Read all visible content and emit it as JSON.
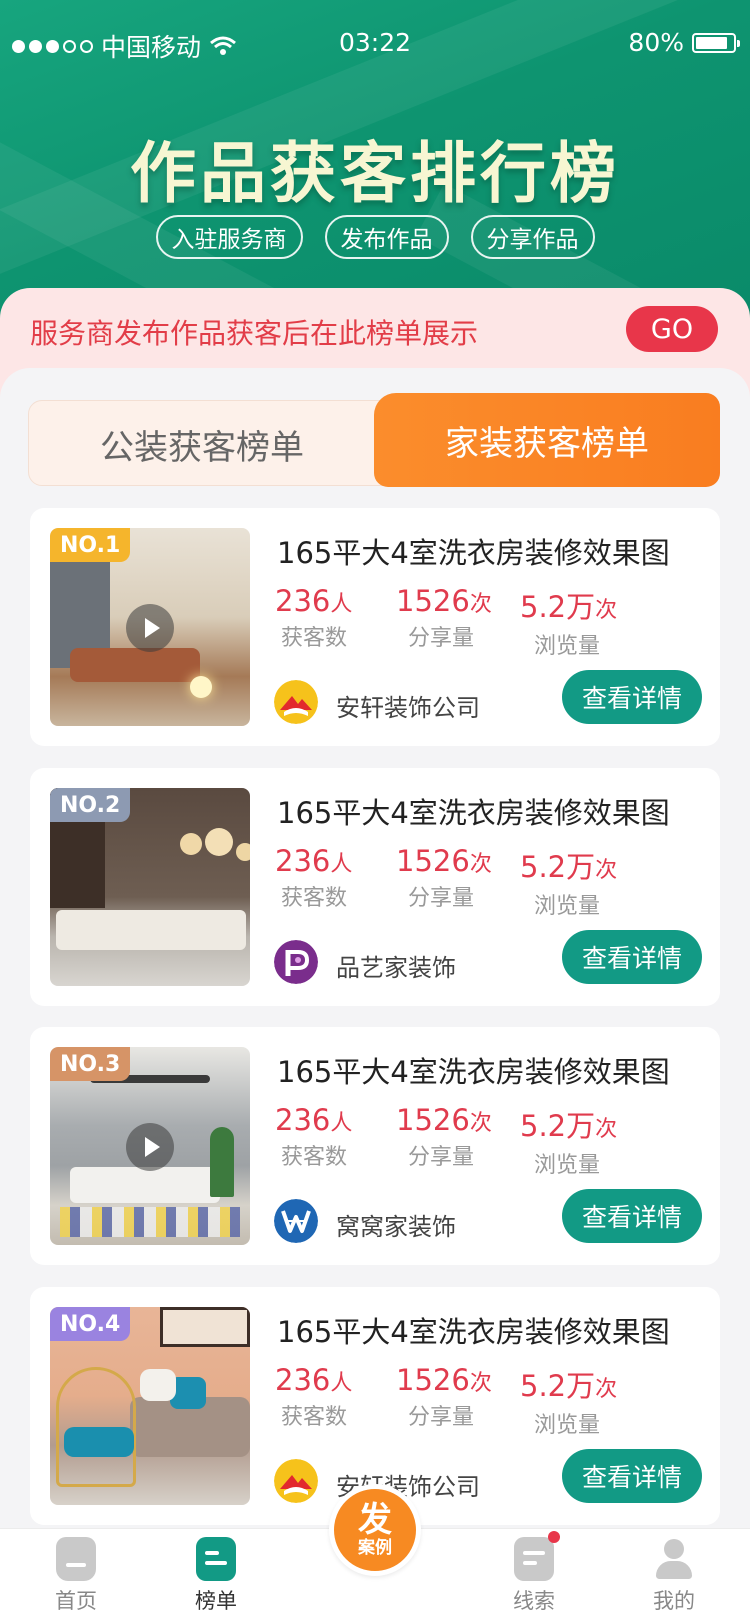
{
  "status_bar": {
    "carrier": "中国移动",
    "time": "03:22",
    "battery": "80%"
  },
  "hero": {
    "title": "作品获客排行榜",
    "buttons": [
      "入驻服务商",
      "发布作品",
      "分享作品"
    ]
  },
  "notice": {
    "text": "服务商发布作品获客后在此榜单展示",
    "go_label": "GO"
  },
  "tabs": [
    {
      "label": "公装获客榜单",
      "active": false
    },
    {
      "label": "家装获客榜单",
      "active": true
    }
  ],
  "cards": [
    {
      "rank": "NO.1",
      "rank_color": "#f5b52c",
      "title": "165平大4室洗衣房装修效果图",
      "customers": "236",
      "customers_unit": "人",
      "customers_label": "获客数",
      "shares": "1526",
      "shares_unit": "次",
      "shares_label": "分享量",
      "views": "5.2万",
      "views_unit": "次",
      "views_label": "浏览量",
      "company": "安轩装饰公司",
      "company_logo": "yellow-red-logo-icon",
      "has_video": true,
      "button": "查看详情"
    },
    {
      "rank": "NO.2",
      "rank_color": "#8d9ab2",
      "title": "165平大4室洗衣房装修效果图",
      "customers": "236",
      "customers_unit": "人",
      "customers_label": "获客数",
      "shares": "1526",
      "shares_unit": "次",
      "shares_label": "分享量",
      "views": "5.2万",
      "views_unit": "次",
      "views_label": "浏览量",
      "company": "品艺家装饰",
      "company_logo": "purple-p-logo-icon",
      "has_video": false,
      "button": "查看详情"
    },
    {
      "rank": "NO.3",
      "rank_color": "#d69467",
      "title": "165平大4室洗衣房装修效果图",
      "customers": "236",
      "customers_unit": "人",
      "customers_label": "获客数",
      "shares": "1526",
      "shares_unit": "次",
      "shares_label": "分享量",
      "views": "5.2万",
      "views_unit": "次",
      "views_label": "浏览量",
      "company": "窝窝家装饰",
      "company_logo": "blue-w-logo-icon",
      "has_video": true,
      "button": "查看详情"
    },
    {
      "rank": "NO.4",
      "rank_color": "#9a83e0",
      "title": "165平大4室洗衣房装修效果图",
      "customers": "236",
      "customers_unit": "人",
      "customers_label": "获客数",
      "shares": "1526",
      "shares_unit": "次",
      "shares_label": "分享量",
      "views": "5.2万",
      "views_unit": "次",
      "views_label": "浏览量",
      "company": "安轩装饰公司",
      "company_logo": "yellow-red-logo-icon",
      "has_video": false,
      "button": "查看详情"
    }
  ],
  "bottom_nav": {
    "items": [
      {
        "label": "首页",
        "icon": "home-icon"
      },
      {
        "label": "榜单",
        "icon": "ranking-icon",
        "active": true
      },
      {
        "label": "线索",
        "icon": "leads-icon",
        "badge": true
      },
      {
        "label": "我的",
        "icon": "profile-icon"
      }
    ],
    "fab_big": "发",
    "fab_small": "案例"
  },
  "colors": {
    "brand_green": "#129a85",
    "accent_orange": "#f97d20",
    "accent_red": "#e8364a"
  }
}
